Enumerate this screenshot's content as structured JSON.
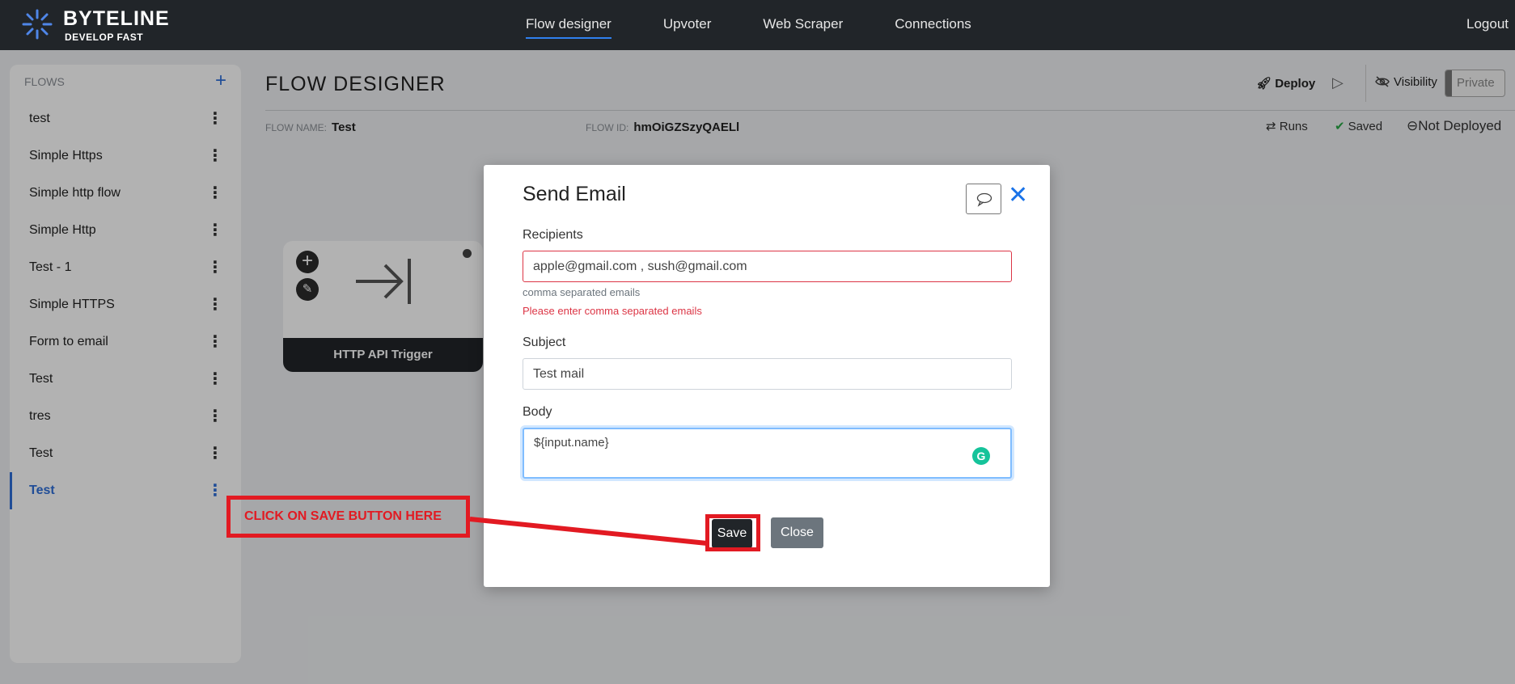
{
  "brand": {
    "name": "BYTELINE",
    "tagline": "DEVELOP FAST"
  },
  "nav": {
    "items": [
      {
        "label": "Flow designer",
        "active": true
      },
      {
        "label": "Upvoter",
        "active": false
      },
      {
        "label": "Web Scraper",
        "active": false
      },
      {
        "label": "Connections",
        "active": false
      }
    ],
    "logout": "Logout"
  },
  "sidebar": {
    "heading": "FLOWS",
    "add_label": "+",
    "items": [
      {
        "label": "test"
      },
      {
        "label": "Simple Https"
      },
      {
        "label": "Simple http flow"
      },
      {
        "label": "Simple Http"
      },
      {
        "label": "Test - 1"
      },
      {
        "label": "Simple HTTPS"
      },
      {
        "label": "Form to email"
      },
      {
        "label": "Test"
      },
      {
        "label": "tres"
      },
      {
        "label": "Test"
      },
      {
        "label": "Test",
        "active": true
      }
    ]
  },
  "header": {
    "title": "FLOW DESIGNER",
    "flow_name_label": "FLOW NAME:",
    "flow_name": "Test",
    "flow_id_label": "FLOW ID:",
    "flow_id": "hmOiGZSzyQAELl",
    "deploy": "Deploy",
    "visibility": "Visibility",
    "private": "Private",
    "runs": "Runs",
    "saved": "Saved",
    "not_deployed": "Not Deployed"
  },
  "node": {
    "label": "HTTP API Trigger"
  },
  "modal": {
    "title": "Send Email",
    "recipients_label": "Recipients",
    "recipients_value": "apple@gmail.com , sush@gmail.com",
    "recipients_hint": "comma separated emails",
    "recipients_error": "Please enter comma separated emails",
    "subject_label": "Subject",
    "subject_value": "Test mail",
    "body_label": "Body",
    "body_value": "${input.name}",
    "save": "Save",
    "close": "Close"
  },
  "annotation": {
    "text": "CLICK ON SAVE BUTTON HERE",
    "color": "#e21a22"
  },
  "colors": {
    "accent": "#2f6fd8",
    "nav_bg": "#212529",
    "error": "#dc3545",
    "grammarly": "#15c39a"
  }
}
